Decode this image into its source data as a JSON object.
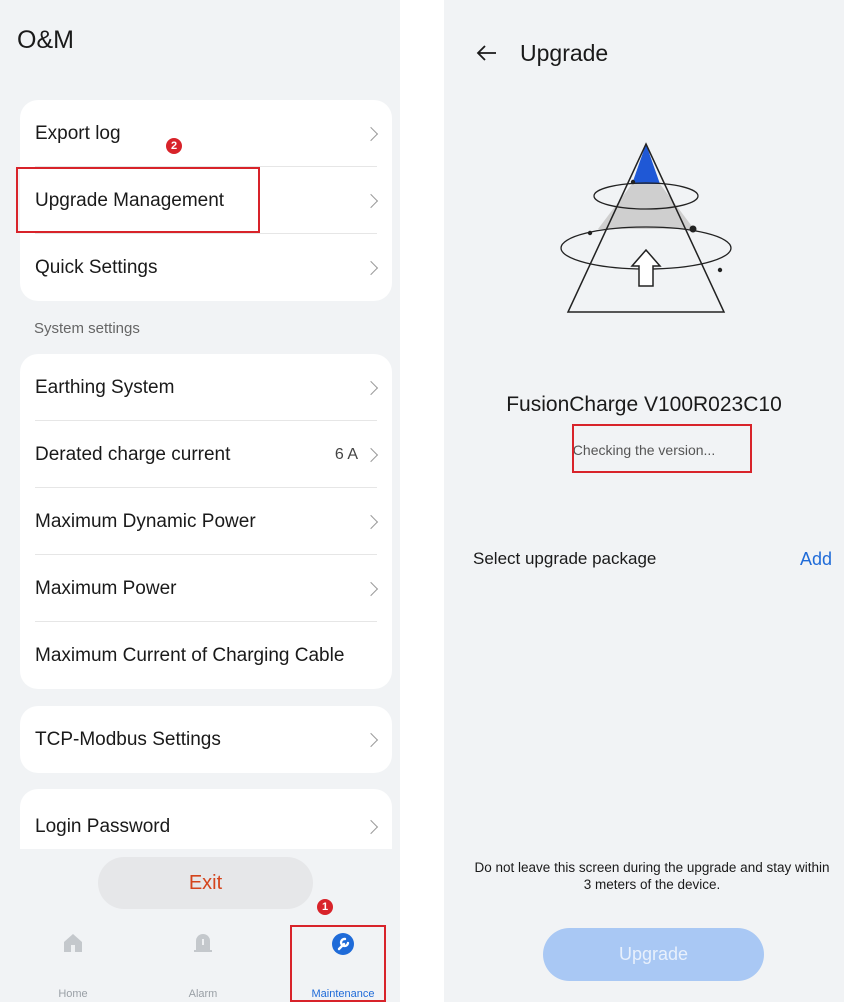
{
  "left": {
    "title": "O&M",
    "group1": [
      {
        "label": "Export log",
        "value": ""
      },
      {
        "label": "Upgrade Management",
        "value": ""
      },
      {
        "label": "Quick Settings",
        "value": ""
      }
    ],
    "section_label": "System settings",
    "group2": [
      {
        "label": "Earthing System",
        "value": ""
      },
      {
        "label": "Derated charge current",
        "value": "6 A"
      },
      {
        "label": "Maximum Dynamic Power",
        "value": ""
      },
      {
        "label": "Maximum Power",
        "value": ""
      },
      {
        "label": "Maximum Current of Charging Cable",
        "value": ""
      }
    ],
    "group3": [
      {
        "label": "TCP-Modbus Settings",
        "value": ""
      }
    ],
    "group4": [
      {
        "label": "Login Password",
        "value": ""
      }
    ],
    "exit_label": "Exit",
    "nav": [
      {
        "label": "Home",
        "icon": "home-icon"
      },
      {
        "label": "Alarm",
        "icon": "bell-icon"
      },
      {
        "label": "Maintenance",
        "icon": "wrench-icon",
        "active": true
      }
    ],
    "annotations": {
      "badge_1": "1",
      "badge_2": "2"
    }
  },
  "right": {
    "title": "Upgrade",
    "product_name": "FusionCharge V100R023C10",
    "status_text": "Checking the version...",
    "package_label": "Select upgrade package",
    "add_label": "Add",
    "notice": "Do not leave this screen during the upgrade and stay within 3 meters of the device.",
    "upgrade_label": "Upgrade"
  },
  "colors": {
    "accent": "#1f6bd8",
    "annotation_red": "#d8232a",
    "exit_text": "#d4441c",
    "disabled_button": "#a9c8f4",
    "screen_bg": "#f1f3f5"
  }
}
